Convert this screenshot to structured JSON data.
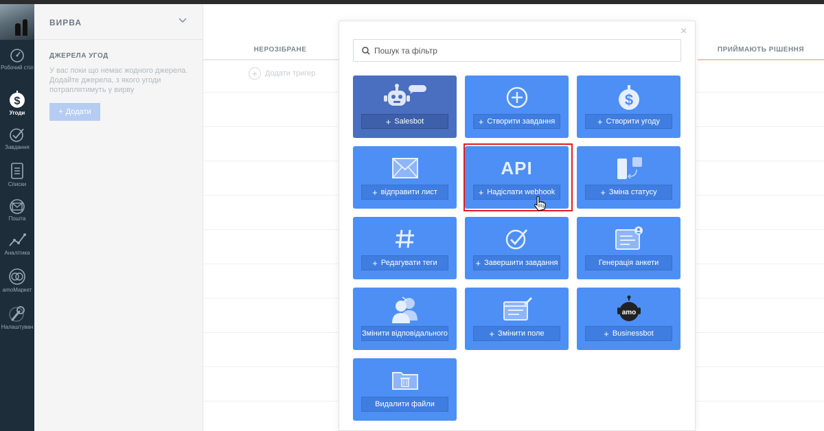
{
  "nav": {
    "items": [
      {
        "label": "Робочий стіл",
        "icon": "dashboard-icon"
      },
      {
        "label": "Угоди",
        "icon": "deals-dollar-icon"
      },
      {
        "label": "Завдання",
        "icon": "tasks-check-icon"
      },
      {
        "label": "Списки",
        "icon": "lists-icon"
      },
      {
        "label": "Пошта",
        "icon": "mail-icon"
      },
      {
        "label": "Аналітика",
        "icon": "analytics-icon"
      },
      {
        "label": "amoМаркет",
        "icon": "market-icon"
      },
      {
        "label": "Налаштуван",
        "icon": "settings-icon"
      }
    ]
  },
  "pipeline": {
    "title": "ВИРВА"
  },
  "sources": {
    "title": "ДЖЕРЕЛА УГОД",
    "text": "У вас поки що немає жодного джерела. Додайте джерела, з якого угоди потраплятимуть у вирву",
    "add_label": "Додати"
  },
  "board": {
    "columns": [
      {
        "label": "НЕРОЗІБРАНЕ"
      },
      {
        "label": "ПРИЙМАЮТЬ РІШЕННЯ"
      }
    ],
    "add_trigger_label": "Додати тригер"
  },
  "modal": {
    "close": "×",
    "search_placeholder": "Пошук та фільтр",
    "tiles": [
      {
        "label": "Salesbot",
        "icon": "salesbot-robot-icon"
      },
      {
        "label": "Створити завдання",
        "icon": "plus-circle-icon"
      },
      {
        "label": "Створити угоду",
        "icon": "dollar-icon"
      },
      {
        "label": "відправити лист",
        "icon": "envelope-icon"
      },
      {
        "label": "Надіслати webhook",
        "icon": "api-icon",
        "icon_text": "API"
      },
      {
        "label": "Зміна статусу",
        "icon": "status-change-icon"
      },
      {
        "label": "Редагувати теги",
        "icon": "hashtag-icon"
      },
      {
        "label": "Завершити завдання",
        "icon": "check-circle-icon"
      },
      {
        "label": "Генерація анкети",
        "icon": "form-profile-icon"
      },
      {
        "label": "Змінити відповідального",
        "icon": "users-swap-icon"
      },
      {
        "label": "Змінити поле",
        "icon": "edit-field-icon"
      },
      {
        "label": "Businessbot",
        "icon": "businessbot-icon",
        "icon_text": "amo"
      },
      {
        "label": "Видалити файли",
        "icon": "folder-delete-icon"
      }
    ]
  },
  "colors": {
    "nav_bg": "#1d2d3a",
    "tile_blue": "#4d8ff5",
    "tile_dark": "#4a6ec0",
    "highlight": "#e31b1b",
    "column_accent": "#f5c994"
  }
}
